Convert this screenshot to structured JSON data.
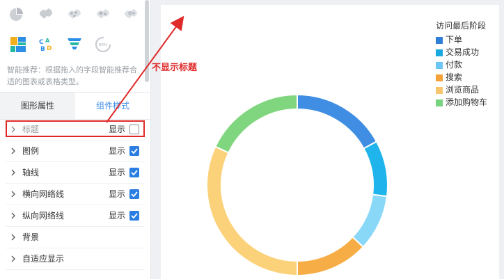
{
  "panel": {
    "chart_type_icons": [
      "pie-icon",
      "china-map-icon",
      "scatter-map-icon",
      "bubble-map-icon",
      "heat-map-icon",
      "treemap-icon",
      "word-cloud-icon",
      "funnel-icon",
      "gauge-icon"
    ],
    "gauge_percent_label": "60%",
    "hint": "智能推荐：根据拖入的字段智能推荐合适的图表或表格类型。",
    "tabs": [
      {
        "label": "图形属性",
        "active": true
      },
      {
        "label": "组件样式",
        "active": false
      }
    ],
    "properties": [
      {
        "label": "标题",
        "show_label": "显示",
        "checked": false
      },
      {
        "label": "图例",
        "show_label": "显示",
        "checked": true
      },
      {
        "label": "轴线",
        "show_label": "显示",
        "checked": true
      },
      {
        "label": "横向网络线",
        "show_label": "显示",
        "checked": true
      },
      {
        "label": "纵向网络线",
        "show_label": "显示",
        "checked": true
      },
      {
        "label": "背景"
      },
      {
        "label": "自适应显示"
      }
    ]
  },
  "annotation": {
    "text": "不显示标题",
    "color": "#e02a2a"
  },
  "legend": {
    "title": "访问最后阶段",
    "items": [
      {
        "label": "下单",
        "color": "#2f7fd8"
      },
      {
        "label": "交易成功",
        "color": "#19a9e0"
      },
      {
        "label": "付款",
        "color": "#6cc6f5"
      },
      {
        "label": "搜索",
        "color": "#f6a23a"
      },
      {
        "label": "浏览商品",
        "color": "#f9c56e"
      },
      {
        "label": "添加购物车",
        "color": "#79d27e"
      }
    ]
  },
  "chart_data": {
    "type": "pie",
    "donut": true,
    "title": "",
    "categories": [
      "下单",
      "交易成功",
      "付款",
      "搜索",
      "浏览商品",
      "添加购物车"
    ],
    "values": [
      17,
      10,
      10,
      13,
      32,
      18
    ],
    "colors": [
      "#3f8ee3",
      "#1fb5ec",
      "#8ad8f8",
      "#f7ad45",
      "#fbd27a",
      "#7fd67f"
    ],
    "legend": "top-right"
  }
}
